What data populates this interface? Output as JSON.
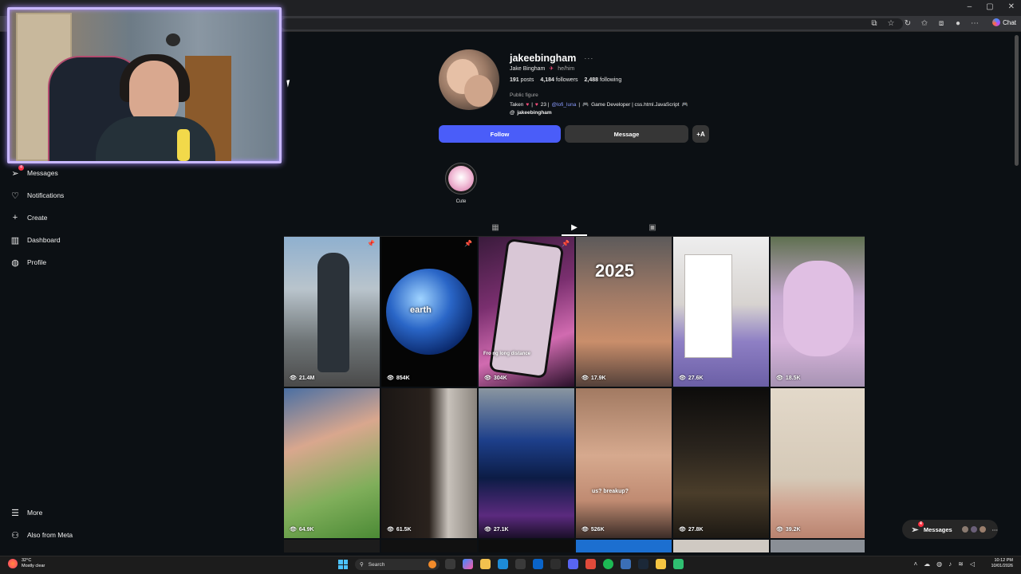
{
  "browser": {
    "chat_label": "Chat",
    "min": "–",
    "max": "▢",
    "close": "✕"
  },
  "nav": {
    "messages": "Messages",
    "messages_badge": "4",
    "notifications": "Notifications",
    "create": "Create",
    "dashboard": "Dashboard",
    "profile": "Profile",
    "more": "More",
    "also_from_meta": "Also from Meta"
  },
  "profile": {
    "username": "jakeebingham",
    "more_dots": "···",
    "full_name": "Jake Bingham",
    "pronouns": "he/him",
    "posts": "191",
    "posts_label": "posts",
    "followers": "4,184",
    "followers_label": "followers",
    "following": "2,488",
    "following_label": "following",
    "category": "Public figure",
    "bio_taken": "Taken",
    "bio_sep1": "|",
    "bio_age": "23 |",
    "bio_mention": "@lofi_luna",
    "bio_sep2": "|",
    "bio_job": "Game Developer | css.html.JavaScript",
    "threads_handle": "jakeebingham",
    "follow_button": "Follow",
    "message_button": "Message",
    "suggest_icon": "+A"
  },
  "highlights": [
    {
      "label": "Cute"
    }
  ],
  "posts": [
    {
      "views": "21.4M",
      "pinned": true
    },
    {
      "views": "854K",
      "pinned": true,
      "overlay": "earth"
    },
    {
      "views": "304K",
      "pinned": true,
      "overlay": "Fro    ng long distance"
    },
    {
      "views": "17.9K",
      "pinned": false,
      "overlay": "2025"
    },
    {
      "views": "27.6K",
      "pinned": false
    },
    {
      "views": "18.5K",
      "pinned": false
    },
    {
      "views": "64.9K",
      "pinned": false
    },
    {
      "views": "61.5K",
      "pinned": false
    },
    {
      "views": "27.1K",
      "pinned": false
    },
    {
      "views": "526K",
      "pinned": false,
      "overlay": "us? breakup?"
    },
    {
      "views": "27.8K",
      "pinned": false
    },
    {
      "views": "39.2K",
      "pinned": false
    }
  ],
  "messages_pill": {
    "label": "Messages",
    "badge": "4"
  },
  "taskbar": {
    "temp": "32°C",
    "weather": "Mostly clear",
    "search_placeholder": "Search",
    "time": "10:12 PM",
    "date": "10/01/2026"
  }
}
